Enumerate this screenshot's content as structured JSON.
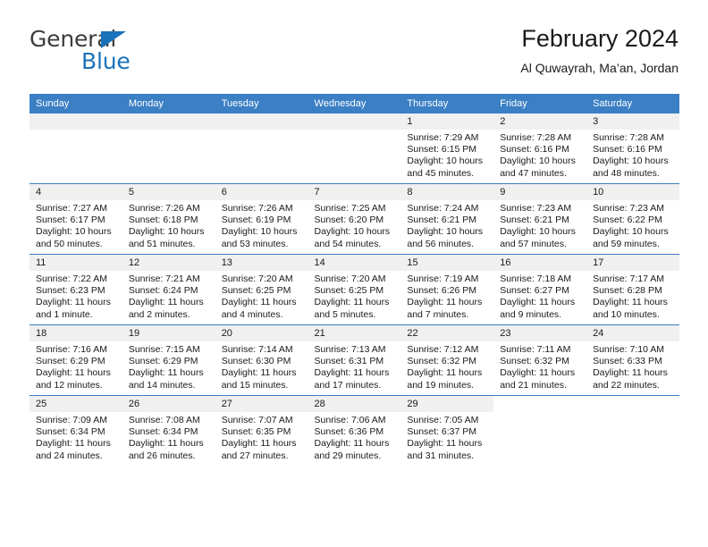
{
  "brand": {
    "name_part1": "General",
    "name_part2": "Blue",
    "logo_icon": "triangle-icon"
  },
  "header": {
    "title": "February 2024",
    "subtitle": "Al Quwayrah, Ma’an, Jordan"
  },
  "colors": {
    "header_blue": "#3b7fc4",
    "brand_blue": "#1a72ba",
    "daynum_band": "#f0f0f0",
    "text": "#1a1a1a"
  },
  "weekdays": [
    "Sunday",
    "Monday",
    "Tuesday",
    "Wednesday",
    "Thursday",
    "Friday",
    "Saturday"
  ],
  "weeks": [
    [
      {
        "day": "",
        "lines": []
      },
      {
        "day": "",
        "lines": []
      },
      {
        "day": "",
        "lines": []
      },
      {
        "day": "",
        "lines": []
      },
      {
        "day": "1",
        "lines": [
          "Sunrise: 7:29 AM",
          "Sunset: 6:15 PM",
          "Daylight: 10 hours",
          "and 45 minutes."
        ]
      },
      {
        "day": "2",
        "lines": [
          "Sunrise: 7:28 AM",
          "Sunset: 6:16 PM",
          "Daylight: 10 hours",
          "and 47 minutes."
        ]
      },
      {
        "day": "3",
        "lines": [
          "Sunrise: 7:28 AM",
          "Sunset: 6:16 PM",
          "Daylight: 10 hours",
          "and 48 minutes."
        ]
      }
    ],
    [
      {
        "day": "4",
        "lines": [
          "Sunrise: 7:27 AM",
          "Sunset: 6:17 PM",
          "Daylight: 10 hours",
          "and 50 minutes."
        ]
      },
      {
        "day": "5",
        "lines": [
          "Sunrise: 7:26 AM",
          "Sunset: 6:18 PM",
          "Daylight: 10 hours",
          "and 51 minutes."
        ]
      },
      {
        "day": "6",
        "lines": [
          "Sunrise: 7:26 AM",
          "Sunset: 6:19 PM",
          "Daylight: 10 hours",
          "and 53 minutes."
        ]
      },
      {
        "day": "7",
        "lines": [
          "Sunrise: 7:25 AM",
          "Sunset: 6:20 PM",
          "Daylight: 10 hours",
          "and 54 minutes."
        ]
      },
      {
        "day": "8",
        "lines": [
          "Sunrise: 7:24 AM",
          "Sunset: 6:21 PM",
          "Daylight: 10 hours",
          "and 56 minutes."
        ]
      },
      {
        "day": "9",
        "lines": [
          "Sunrise: 7:23 AM",
          "Sunset: 6:21 PM",
          "Daylight: 10 hours",
          "and 57 minutes."
        ]
      },
      {
        "day": "10",
        "lines": [
          "Sunrise: 7:23 AM",
          "Sunset: 6:22 PM",
          "Daylight: 10 hours",
          "and 59 minutes."
        ]
      }
    ],
    [
      {
        "day": "11",
        "lines": [
          "Sunrise: 7:22 AM",
          "Sunset: 6:23 PM",
          "Daylight: 11 hours",
          "and 1 minute."
        ]
      },
      {
        "day": "12",
        "lines": [
          "Sunrise: 7:21 AM",
          "Sunset: 6:24 PM",
          "Daylight: 11 hours",
          "and 2 minutes."
        ]
      },
      {
        "day": "13",
        "lines": [
          "Sunrise: 7:20 AM",
          "Sunset: 6:25 PM",
          "Daylight: 11 hours",
          "and 4 minutes."
        ]
      },
      {
        "day": "14",
        "lines": [
          "Sunrise: 7:20 AM",
          "Sunset: 6:25 PM",
          "Daylight: 11 hours",
          "and 5 minutes."
        ]
      },
      {
        "day": "15",
        "lines": [
          "Sunrise: 7:19 AM",
          "Sunset: 6:26 PM",
          "Daylight: 11 hours",
          "and 7 minutes."
        ]
      },
      {
        "day": "16",
        "lines": [
          "Sunrise: 7:18 AM",
          "Sunset: 6:27 PM",
          "Daylight: 11 hours",
          "and 9 minutes."
        ]
      },
      {
        "day": "17",
        "lines": [
          "Sunrise: 7:17 AM",
          "Sunset: 6:28 PM",
          "Daylight: 11 hours",
          "and 10 minutes."
        ]
      }
    ],
    [
      {
        "day": "18",
        "lines": [
          "Sunrise: 7:16 AM",
          "Sunset: 6:29 PM",
          "Daylight: 11 hours",
          "and 12 minutes."
        ]
      },
      {
        "day": "19",
        "lines": [
          "Sunrise: 7:15 AM",
          "Sunset: 6:29 PM",
          "Daylight: 11 hours",
          "and 14 minutes."
        ]
      },
      {
        "day": "20",
        "lines": [
          "Sunrise: 7:14 AM",
          "Sunset: 6:30 PM",
          "Daylight: 11 hours",
          "and 15 minutes."
        ]
      },
      {
        "day": "21",
        "lines": [
          "Sunrise: 7:13 AM",
          "Sunset: 6:31 PM",
          "Daylight: 11 hours",
          "and 17 minutes."
        ]
      },
      {
        "day": "22",
        "lines": [
          "Sunrise: 7:12 AM",
          "Sunset: 6:32 PM",
          "Daylight: 11 hours",
          "and 19 minutes."
        ]
      },
      {
        "day": "23",
        "lines": [
          "Sunrise: 7:11 AM",
          "Sunset: 6:32 PM",
          "Daylight: 11 hours",
          "and 21 minutes."
        ]
      },
      {
        "day": "24",
        "lines": [
          "Sunrise: 7:10 AM",
          "Sunset: 6:33 PM",
          "Daylight: 11 hours",
          "and 22 minutes."
        ]
      }
    ],
    [
      {
        "day": "25",
        "lines": [
          "Sunrise: 7:09 AM",
          "Sunset: 6:34 PM",
          "Daylight: 11 hours",
          "and 24 minutes."
        ]
      },
      {
        "day": "26",
        "lines": [
          "Sunrise: 7:08 AM",
          "Sunset: 6:34 PM",
          "Daylight: 11 hours",
          "and 26 minutes."
        ]
      },
      {
        "day": "27",
        "lines": [
          "Sunrise: 7:07 AM",
          "Sunset: 6:35 PM",
          "Daylight: 11 hours",
          "and 27 minutes."
        ]
      },
      {
        "day": "28",
        "lines": [
          "Sunrise: 7:06 AM",
          "Sunset: 6:36 PM",
          "Daylight: 11 hours",
          "and 29 minutes."
        ]
      },
      {
        "day": "29",
        "lines": [
          "Sunrise: 7:05 AM",
          "Sunset: 6:37 PM",
          "Daylight: 11 hours",
          "and 31 minutes."
        ]
      },
      {
        "day": "",
        "lines": []
      },
      {
        "day": "",
        "lines": []
      }
    ]
  ]
}
